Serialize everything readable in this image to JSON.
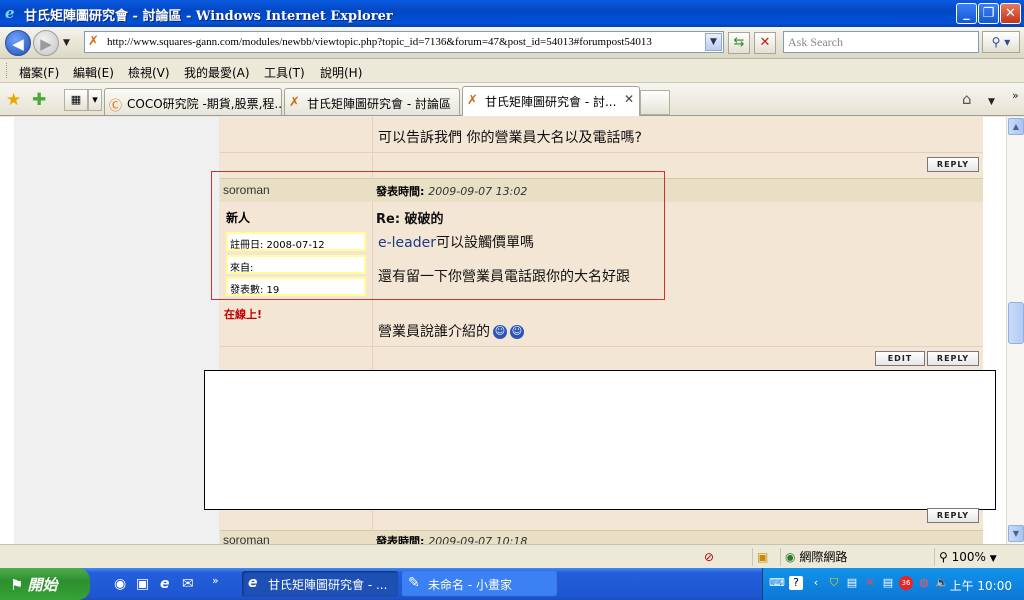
{
  "window": {
    "title": "甘氏矩陣圖研究會 - 討論區 - Windows Internet Explorer",
    "icon": "ie-icon"
  },
  "address_bar": {
    "url": "http://www.squares-gann.com/modules/newbb/viewtopic.php?topic_id=7136&forum=47&post_id=54013#forumpost54013"
  },
  "search": {
    "placeholder": "Ask Search"
  },
  "menu": {
    "items": [
      "檔案(F)",
      "編輯(E)",
      "檢視(V)",
      "我的最愛(A)",
      "工具(T)",
      "說明(H)"
    ]
  },
  "tabs": [
    {
      "label": "COCO研究院 -期貨,股票,程...",
      "active": false
    },
    {
      "label": "甘氏矩陣圖研究會 - 討論區",
      "active": false
    },
    {
      "label": "甘氏矩陣圖研究會 - 討...",
      "active": true
    }
  ],
  "forum": {
    "prev_post_text": "可以告訴我們 你的營業員大名以及電話嗎?",
    "reply_label": "REPLY",
    "edit_label": "EDIT",
    "post": {
      "author": "soroman",
      "posted_label": "發表時間:",
      "posted_time": "2009-09-07 13:02",
      "rank": "新人",
      "registered": "註冊日: 2008-07-12",
      "from": "來自:",
      "post_count": "發表數: 19",
      "online": "在線上!",
      "subject": "Re: 破破的",
      "body_line1_prefix": "e-leader",
      "body_line1_suffix": "可以設觸價單嗎",
      "body_line2": "還有留一下你營業員電話跟你的大名好跟",
      "body_line3": "營業員說誰介紹的"
    },
    "next_post": {
      "author": "soroman",
      "posted_label": "發表時間:",
      "posted_time": "2009-09-07 10:18"
    }
  },
  "statusbar": {
    "zone": "網際網路",
    "zoom": "100%"
  },
  "taskbar": {
    "start_label": "開始",
    "tasks": [
      {
        "label": "甘氏矩陣圖研究會 - ...",
        "active": true
      },
      {
        "label": "未命名 - 小畫家",
        "active": false
      }
    ],
    "clock": "上午 10:00"
  }
}
